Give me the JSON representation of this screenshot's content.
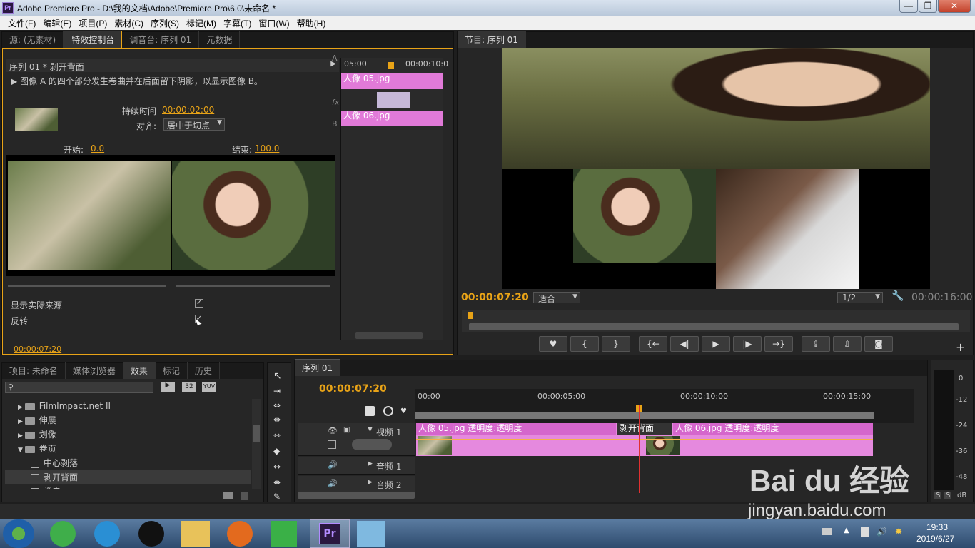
{
  "window": {
    "title": "Adobe Premiere Pro - D:\\我的文档\\Adobe\\Premiere Pro\\6.0\\未命名 *",
    "logo": "Pr"
  },
  "menu": [
    "文件(F)",
    "编辑(E)",
    "项目(P)",
    "素材(C)",
    "序列(S)",
    "标记(M)",
    "字幕(T)",
    "窗口(W)",
    "帮助(H)"
  ],
  "source_panel": {
    "tabs": [
      "源: (无素材)",
      "特效控制台",
      "调音台: 序列 01",
      "元数据"
    ],
    "sequence_label": "序列 01 * 剥开背面",
    "description": "图像 A 的四个部分发生卷曲并在后面留下阴影，以显示图像 B。",
    "duration_label": "持续时间",
    "duration_value": "00:00:02:00",
    "align_label": "对齐:",
    "align_value": "居中于切点",
    "start_label": "开始:",
    "start_value": "0.0",
    "end_label": "结束:",
    "end_value": "100.0",
    "show_source_label": "显示实际来源",
    "reverse_label": "反转",
    "current_time": "00:00:07:20",
    "mini_ruler_start": "05:00",
    "mini_ruler_end": "00:00:10:0",
    "mini_track_a": "A",
    "mini_track_fx": "fx",
    "mini_track_b": "B",
    "clip_a": "人像 05.jpg",
    "clip_b": "人像 06.jpg"
  },
  "program_panel": {
    "tab": "节目: 序列 01",
    "current_time": "00:00:07:20",
    "fit": "适合",
    "quality": "1/2",
    "duration": "00:00:16:00"
  },
  "project_panel": {
    "tabs": [
      "项目: 未命名",
      "媒体浏览器",
      "效果",
      "标记",
      "历史"
    ],
    "badges": [
      "32",
      "YUV"
    ],
    "tree": [
      {
        "label": "FilmImpact.net II",
        "type": "folder",
        "indent": 1,
        "expanded": false
      },
      {
        "label": "伸展",
        "type": "folder",
        "indent": 1,
        "expanded": false
      },
      {
        "label": "划像",
        "type": "folder",
        "indent": 1,
        "expanded": false
      },
      {
        "label": "卷页",
        "type": "folder",
        "indent": 1,
        "expanded": true
      },
      {
        "label": "中心剥落",
        "type": "effect",
        "indent": 2
      },
      {
        "label": "剥开背面",
        "type": "effect",
        "indent": 2,
        "selected": true
      },
      {
        "label": "卷走",
        "type": "effect",
        "indent": 2
      }
    ]
  },
  "timeline": {
    "tab": "序列 01",
    "current_time": "00:00:07:20",
    "ruler": [
      "00:00",
      "00:00:05:00",
      "00:00:10:00",
      "00:00:15:00"
    ],
    "tracks": {
      "video1": "视频 1",
      "audio1": "音频 1",
      "audio2": "音频 2"
    },
    "clip1_name": "人像 05.jpg",
    "clip1_fx": "透明度:透明度",
    "transition": "剥开背面",
    "clip2_name": "人像 06.jpg",
    "clip2_fx": "透明度:透明度"
  },
  "audio_meter": {
    "labels": [
      "0",
      "-12",
      "-24",
      "-36",
      "-48",
      "dB"
    ],
    "solo": [
      "S",
      "S"
    ]
  },
  "watermark": {
    "brand": "Bai du 经验",
    "url": "jingyan.baidu.com"
  },
  "taskbar": {
    "time": "19:33",
    "date": "2019/6/27"
  }
}
